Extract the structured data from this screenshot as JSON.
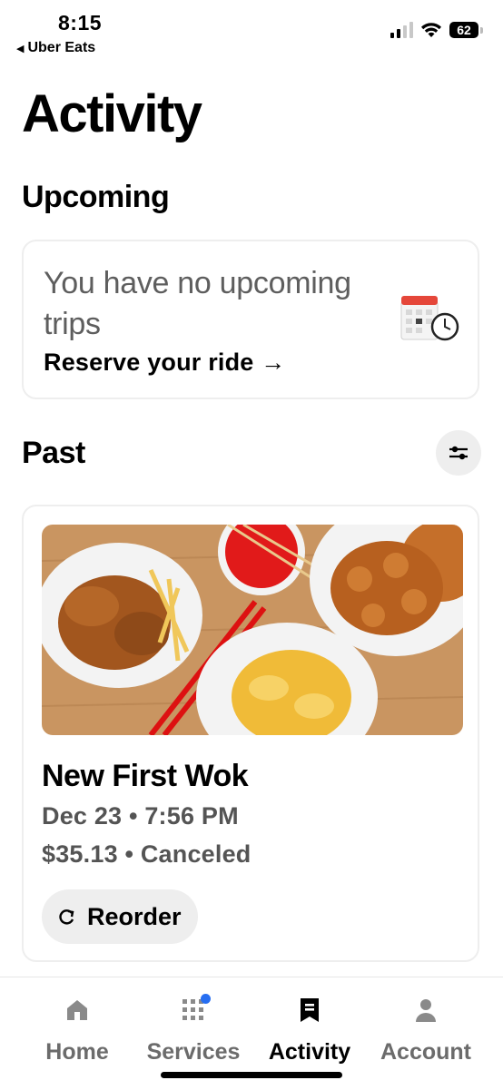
{
  "status_bar": {
    "time": "8:15",
    "back_app": "Uber Eats",
    "back_icon": "triangle-left-icon",
    "battery": "62"
  },
  "page": {
    "title": "Activity"
  },
  "upcoming": {
    "heading": "Upcoming",
    "message": "You have no upcoming trips",
    "link": "Reserve your ride →",
    "icon": "calendar-clock-icon"
  },
  "past": {
    "heading": "Past",
    "filter_icon": "sliders-icon",
    "orders": [
      {
        "restaurant": "New First Wok",
        "datetime": "Dec 23 • 7:56 PM",
        "price_status": "$35.13 • Canceled",
        "reorder_label": "Reorder",
        "reorder_icon": "refresh-icon"
      }
    ]
  },
  "tabs": [
    {
      "label": "Home",
      "icon": "home-icon",
      "active": false
    },
    {
      "label": "Services",
      "icon": "grid-icon",
      "active": false,
      "badge": true
    },
    {
      "label": "Activity",
      "icon": "receipt-icon",
      "active": true
    },
    {
      "label": "Account",
      "icon": "person-icon",
      "active": false
    }
  ],
  "colors": {
    "accent_badge": "#276ef1",
    "muted_text": "#6b6b6b",
    "chip_bg": "#eeeeee"
  }
}
